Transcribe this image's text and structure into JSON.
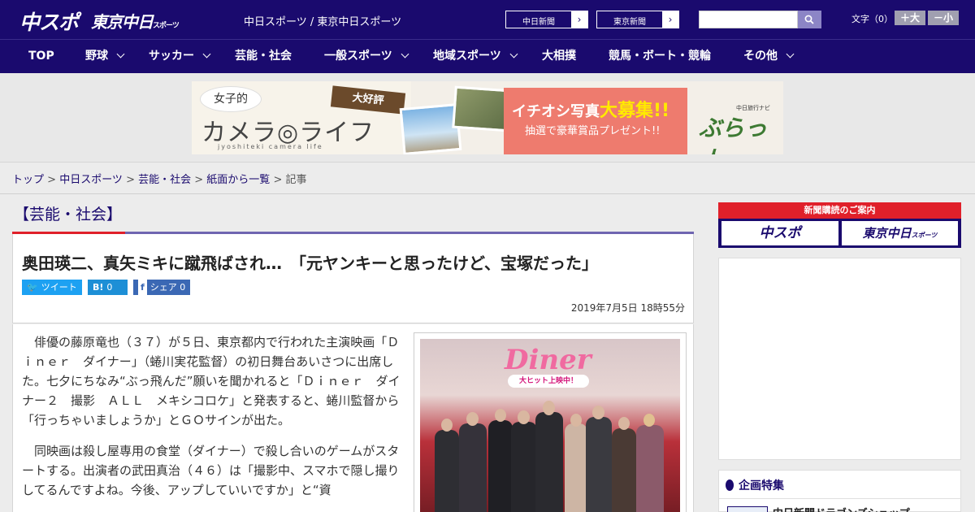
{
  "header": {
    "logo_chuspo": "中スポ",
    "logo_tokyo": "東京中日",
    "logo_tokyo_suffix": "スポーツ",
    "site_names": "中日スポーツ / 東京中日スポーツ",
    "btn_chunichi": "中日新聞",
    "btn_tokyo": "東京新聞",
    "search_placeholder": "",
    "font_size_label": "文字（0）",
    "font_larger": "＋大",
    "font_smaller": "－小"
  },
  "nav": {
    "items": [
      {
        "label": "TOP"
      },
      {
        "label": "野球"
      },
      {
        "label": "サッカー"
      },
      {
        "label": "芸能・社会"
      },
      {
        "label": "一般スポーツ"
      },
      {
        "label": "地域スポーツ"
      },
      {
        "label": "大相撲"
      },
      {
        "label": "競馬・ボート・競輪"
      },
      {
        "label": "その他"
      }
    ]
  },
  "banner": {
    "joshi": "女子的",
    "camera_life": "カメラ◎ライフ",
    "sub": "jyoshiteki camera life",
    "daikouhyou": "大好評",
    "headline_pre": "イチオシ写真",
    "headline_bold": "大募集!!",
    "prize": "抽選で豪華賞品プレゼント!!",
    "navi": "中日旅行ナビ",
    "brand": "ぶらっ人"
  },
  "breadcrumb": {
    "top": "トップ",
    "chunichi": "中日スポーツ",
    "geino": "芸能・社会",
    "shimen": "紙面から一覧",
    "current": "記事",
    "sep": " > "
  },
  "article": {
    "section": "【芸能・社会】",
    "headline": "奥田瑛二、真矢ミキに蹴飛ばされ…　「元ヤンキーと思ったけど、宝塚だった」",
    "share_tweet": "ツイート",
    "share_hatena_icon": "B!",
    "share_hatena_count": "0",
    "share_fb": "シェア",
    "share_fb_count": "0",
    "date": "2019年7月5日 18時55分",
    "paragraphs": [
      "俳優の藤原竜也（３７）が５日、東京都内で行われた主演映画「Ｄｉｎｅｒ　ダイナー」（蜷川実花監督）の初日舞台あいさつに出席した。七夕にちなみ“ぶっ飛んだ”願いを聞かれると「Ｄｉｎｅｒ　ダイナー２　撮影　ＡＬＬ　メキシコロケ」と発表すると、蜷川監督から「行っちゃいましょうか」とＧＯサインが出た。",
      "同映画は殺し屋専用の食堂（ダイナー）で殺し合いのゲームがスタートする。出演者の武田真治（４６）は「撮影中、スマホで隠し撮りしてるんですよね。今後、アップしていいですか」と“資"
    ],
    "photo_title": "Diner",
    "photo_caption": "大ヒット上映中！"
  },
  "sidebar": {
    "subscribe_title": "新聞購読のご案内",
    "sub_chuspo": "中スポ",
    "sub_tokyo": "東京中日",
    "sub_tokyo_suffix": "スポーツ",
    "feature_title": "企画特集",
    "feature_item": "中日新聞ドラゴンズショップ"
  }
}
